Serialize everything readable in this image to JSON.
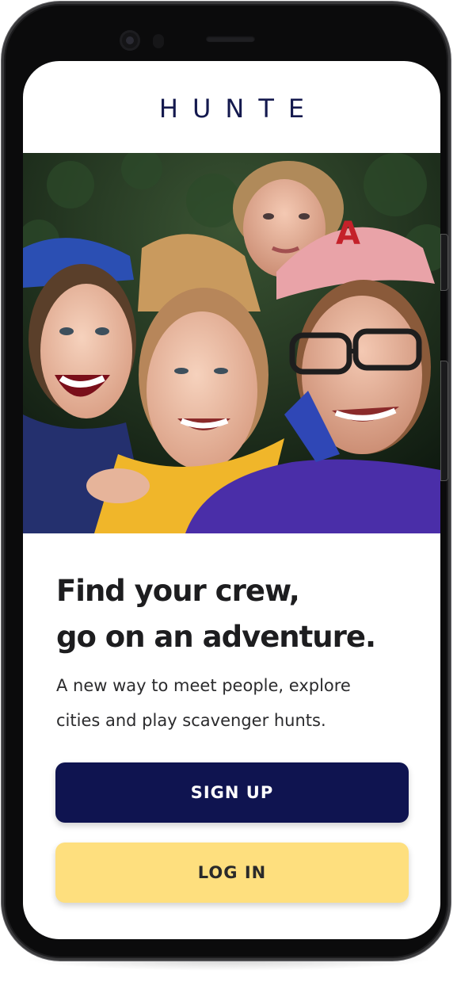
{
  "app": {
    "logo_text": "HUNTE"
  },
  "hero": {
    "image_description": "Group selfie of four smiling friends outdoors"
  },
  "content": {
    "headline_line1": "Find your crew,",
    "headline_line2": "go on an adventure.",
    "subtitle_line1": "A new way to meet people, explore",
    "subtitle_line2": "cities and play scavenger hunts."
  },
  "actions": {
    "signup_label": "SIGN UP",
    "login_label": "LOG IN"
  },
  "colors": {
    "brand_navy": "#0f1450",
    "accent_yellow": "#fedf7e",
    "text_dark": "#1d1d1f"
  }
}
